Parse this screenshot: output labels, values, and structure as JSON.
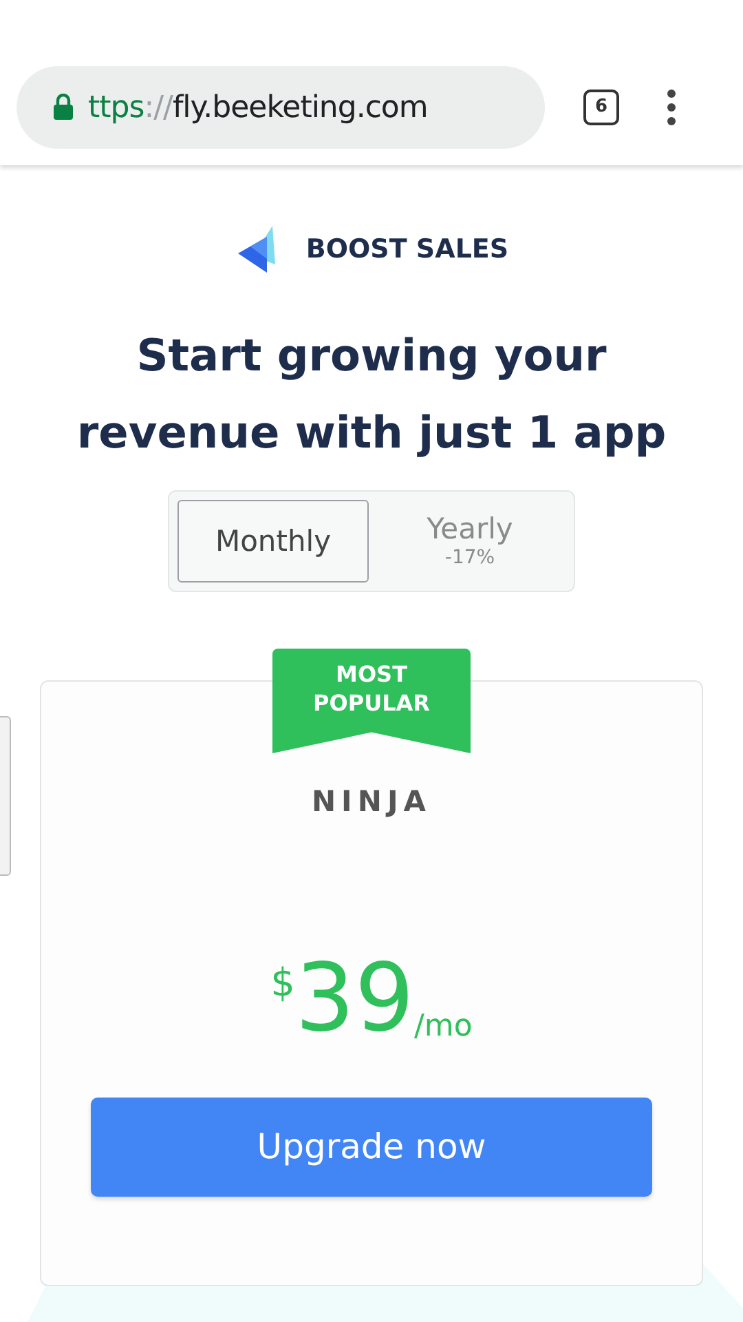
{
  "browser": {
    "url_scheme": "ttps",
    "url_separator": "://",
    "url_host": "fly.beeketing.com",
    "tab_count": "6"
  },
  "brand": {
    "name": "BOOST SALES"
  },
  "heading": "Start growing your revenue with just 1 app",
  "billing_toggle": [
    {
      "label": "Monthly",
      "selected": true
    },
    {
      "label": "Yearly",
      "note": "-17%",
      "selected": false
    }
  ],
  "plan": {
    "ribbon": "MOST POPULAR",
    "name": "NINJA",
    "currency": "$",
    "amount": "39",
    "period": "/mo",
    "button": "Upgrade now"
  }
}
